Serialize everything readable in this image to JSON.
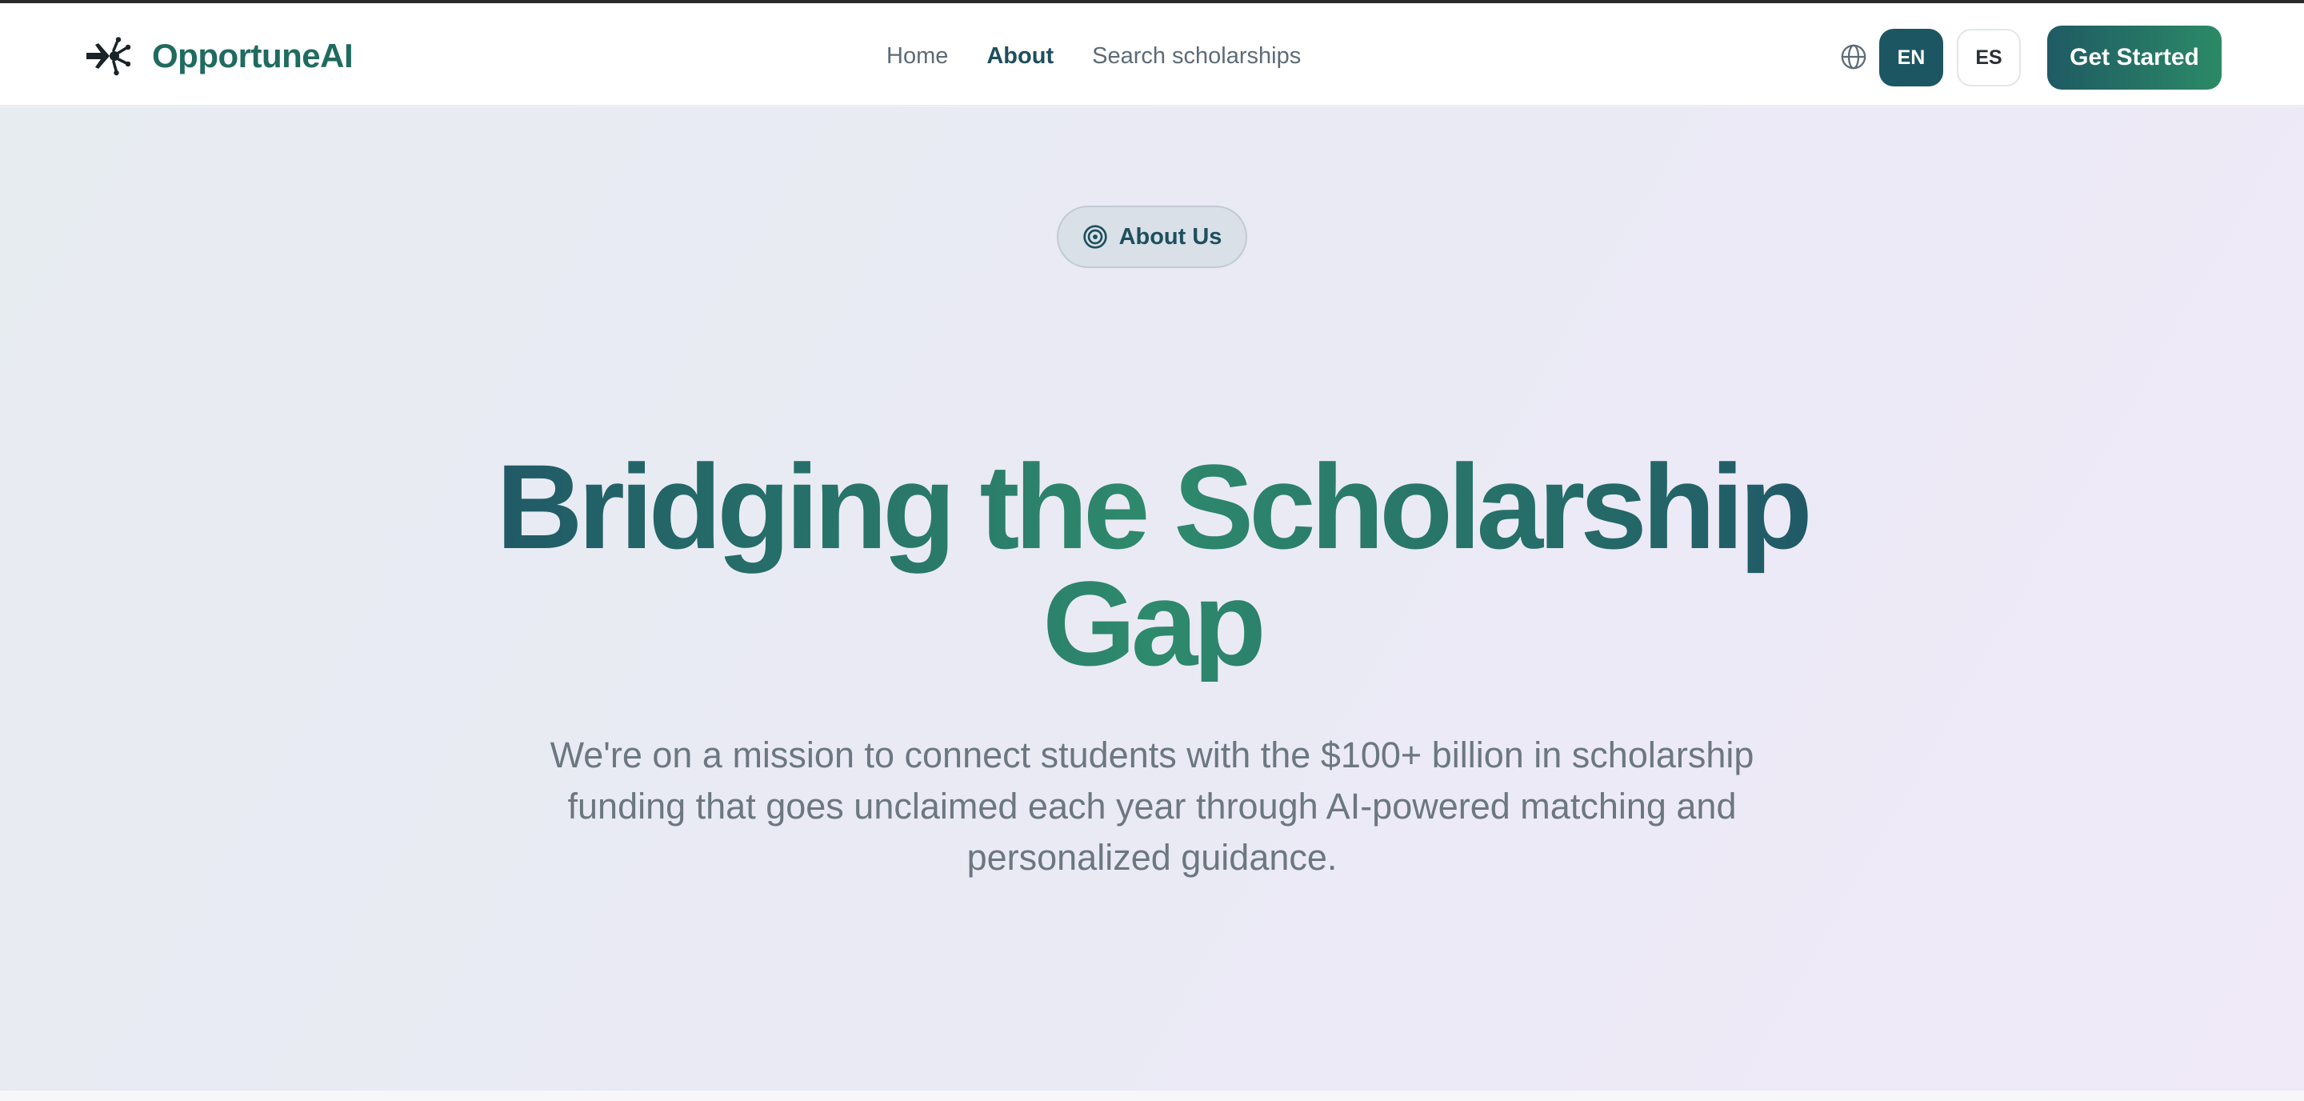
{
  "brand": {
    "name": "OpportuneAI",
    "logo_icon": "sparkle-arrow-icon"
  },
  "nav": {
    "items": [
      {
        "label": "Home",
        "active": false
      },
      {
        "label": "About",
        "active": true
      },
      {
        "label": "Search scholarships",
        "active": false
      }
    ]
  },
  "language": {
    "icon": "globe-icon",
    "options": [
      {
        "label": "EN",
        "selected": true
      },
      {
        "label": "ES",
        "selected": false
      }
    ]
  },
  "cta": {
    "label": "Get Started"
  },
  "hero": {
    "badge": {
      "label": "About Us",
      "icon": "target-icon"
    },
    "headline": "Bridging the Scholarship Gap",
    "lead": "We're on a mission to connect students with the $100+ billion in scholarship funding that goes unclaimed each year through AI-powered matching and personalized guidance."
  },
  "colors": {
    "brand": "#1f6b60",
    "accent_dark": "#1d5663",
    "accent_green": "#2b8a66",
    "text_muted": "#6c7780"
  }
}
